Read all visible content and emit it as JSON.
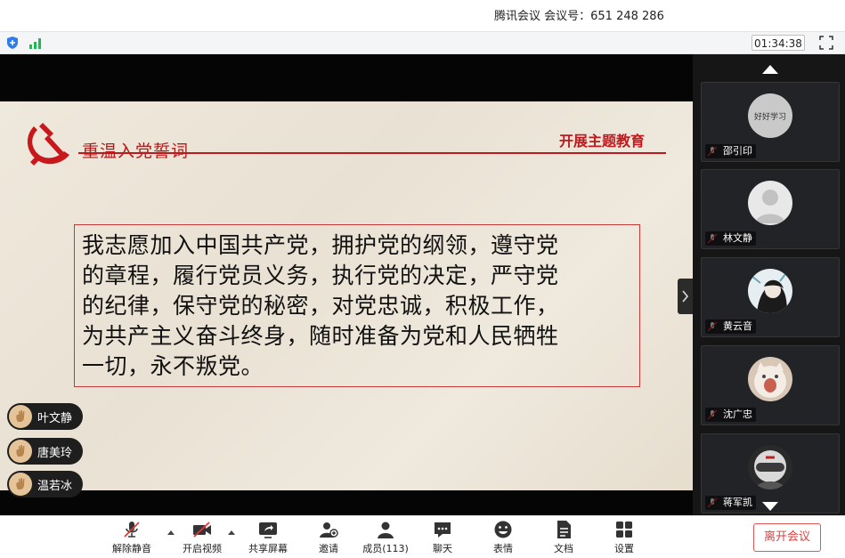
{
  "window": {
    "title": "腾讯会议 会议号：651 248 286"
  },
  "status": {
    "timer": "01:34:38"
  },
  "slide": {
    "title": "重温入党誓词",
    "tag": "开展主题教育",
    "oath_lines": [
      "我志愿加入中国共产党，拥护党的纲领，遵守党",
      "的章程，履行党员义务，执行党的决定，严守党",
      "的纪律，保守党的秘密，对党忠诚，积极工作，",
      "为共产主义奋斗终身，随时准备为党和人民牺牲",
      "一切，永不叛党。"
    ]
  },
  "raised_hands": [
    {
      "name": "叶文静"
    },
    {
      "name": "唐美玲"
    },
    {
      "name": "温若冰"
    }
  ],
  "participants": [
    {
      "name": "邵引印",
      "avatar_text": "好好学习",
      "avatar": "text-avatar"
    },
    {
      "name": "林文静",
      "avatar": "default-person-icon"
    },
    {
      "name": "黄云音",
      "avatar": "anime-avatar"
    },
    {
      "name": "沈广忠",
      "avatar": "cat-avatar"
    },
    {
      "name": "蒋军凯",
      "avatar": "helmet-avatar"
    }
  ],
  "toolbar": {
    "unmute": "解除静音",
    "video": "开启视频",
    "share": "共享屏幕",
    "invite": "邀请",
    "members": "成员(113)",
    "chat": "聊天",
    "emoji": "表情",
    "docs": "文档",
    "settings": "设置",
    "leave": "离开会议"
  },
  "colors": {
    "accent_red": "#c0191d",
    "leave_red": "#e04040",
    "rail_bg": "#161616"
  }
}
